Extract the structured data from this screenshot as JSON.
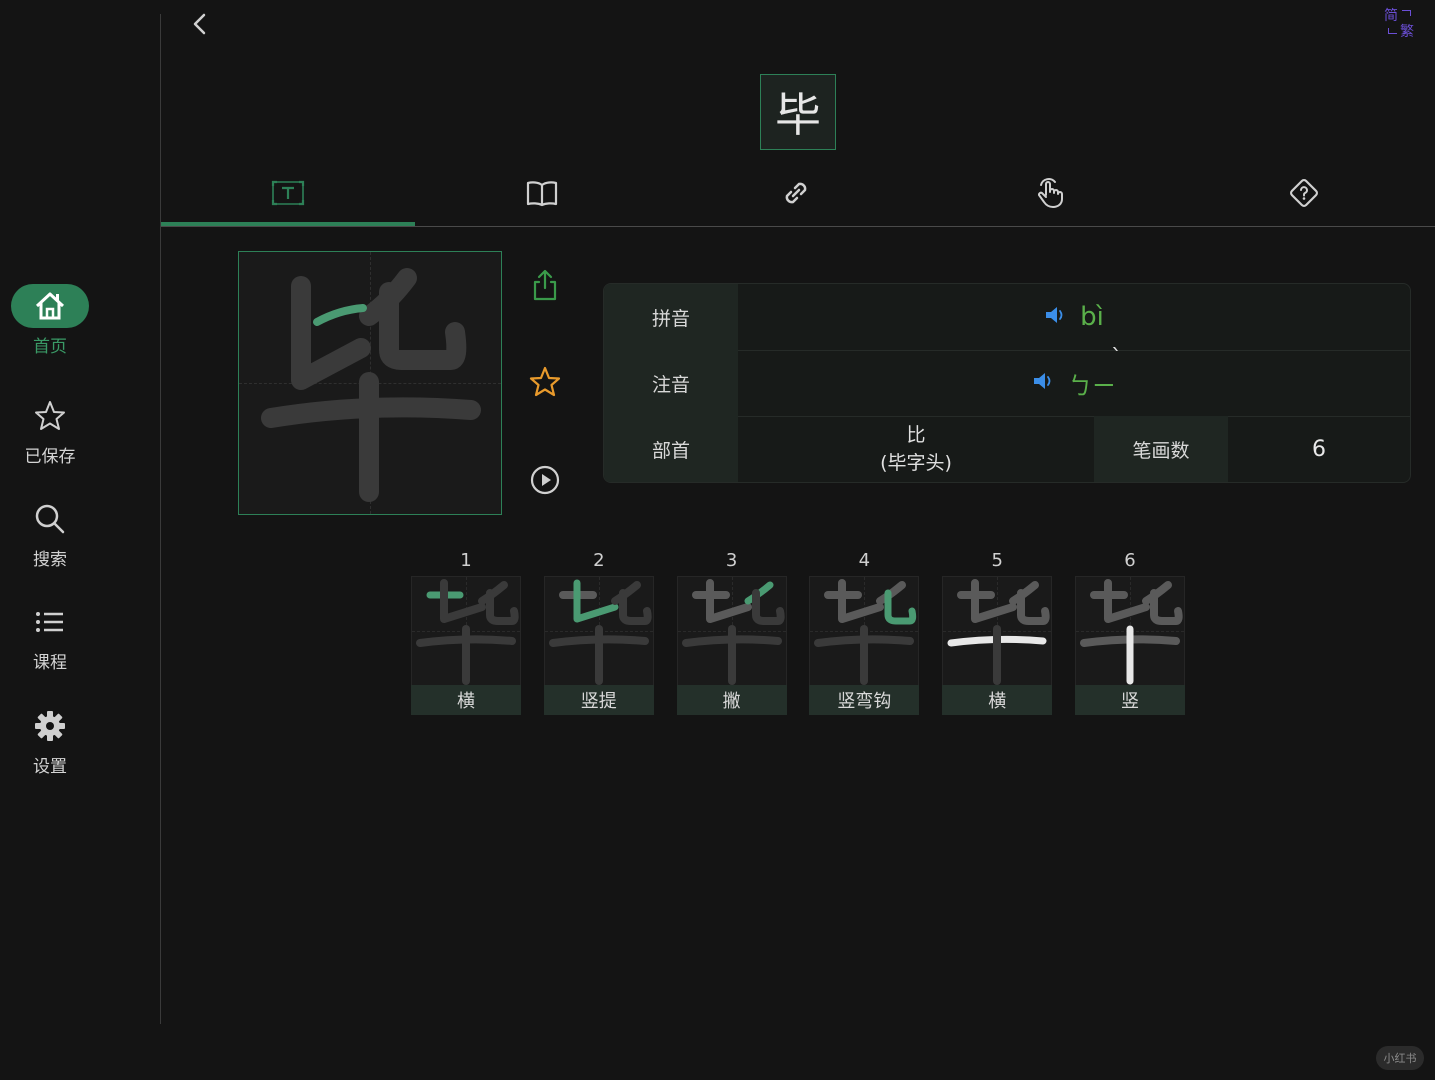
{
  "sidebar": {
    "items": [
      {
        "label": "首页",
        "icon": "home-icon",
        "active": true
      },
      {
        "label": "已保存",
        "icon": "star-icon",
        "active": false
      },
      {
        "label": "搜索",
        "icon": "search-icon",
        "active": false
      },
      {
        "label": "课程",
        "icon": "list-icon",
        "active": false
      },
      {
        "label": "设置",
        "icon": "gear-icon",
        "active": false
      }
    ]
  },
  "header": {
    "character": "毕",
    "script_toggle": {
      "simplified": "简",
      "traditional": "繁"
    }
  },
  "tabs": [
    {
      "icon": "text-card-icon",
      "active": true
    },
    {
      "icon": "book-icon",
      "active": false
    },
    {
      "icon": "link-icon",
      "active": false
    },
    {
      "icon": "hand-pointer-icon",
      "active": false
    },
    {
      "icon": "question-diamond-icon",
      "active": false
    }
  ],
  "info": {
    "pinyin_label": "拼音",
    "pinyin_value": "bì",
    "zhuyin_label": "注音",
    "zhuyin_value": "ㄅㄧ",
    "zhuyin_tone": "ˋ",
    "radical_label": "部首",
    "radical_value": "比",
    "radical_note": "(毕字头)",
    "strokes_label": "笔画数",
    "strokes_value": "6"
  },
  "strokes": [
    {
      "num": "1",
      "name": "横"
    },
    {
      "num": "2",
      "name": "竖提"
    },
    {
      "num": "3",
      "name": "撇"
    },
    {
      "num": "4",
      "name": "竖弯钩"
    },
    {
      "num": "5",
      "name": "横"
    },
    {
      "num": "6",
      "name": "竖"
    }
  ],
  "watermark": "小红书",
  "colors": {
    "accent": "#2d8057",
    "pinyin": "#5ab04a",
    "speaker": "#3b8ee8",
    "star": "#e89a2c",
    "toggle": "#6b4fd6"
  }
}
